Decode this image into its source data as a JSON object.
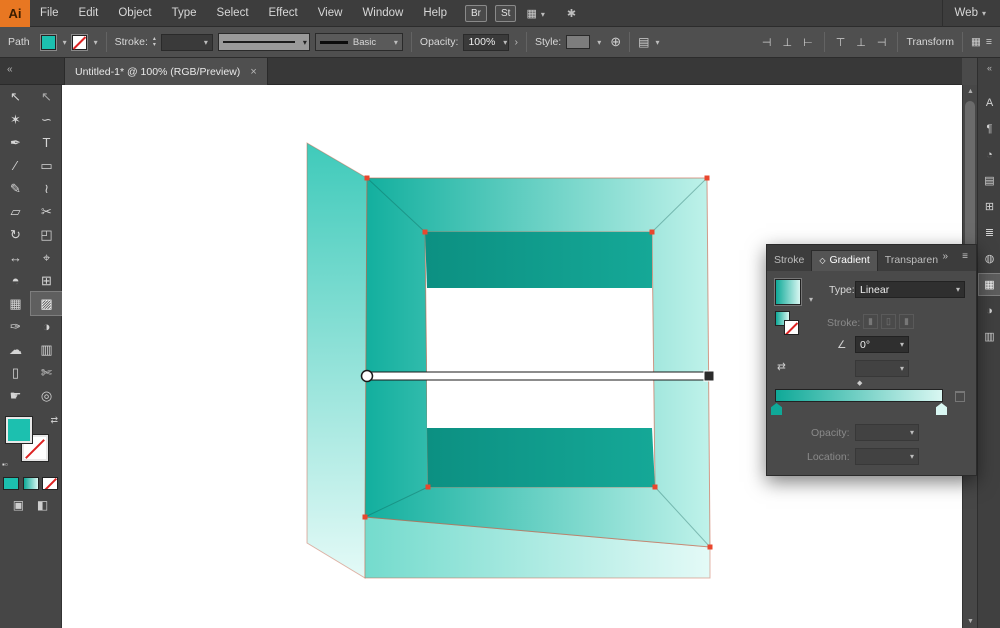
{
  "colors": {
    "teal": "#1CC0AF",
    "grad_left": "#12AF9E",
    "grad_right": "#BFF2EA",
    "face_light_top": "#3FCABA",
    "face_light_bottom": "#E4FAF7",
    "bottom_left": "#74DBCD",
    "bottom_right": "#E4FAF7",
    "wall_dark": "#0C9082",
    "wall_dark2": "#15A897",
    "anchor": "#E9472E"
  },
  "menubar": {
    "logo": "Ai",
    "items": [
      "File",
      "Edit",
      "Object",
      "Type",
      "Select",
      "Effect",
      "View",
      "Window",
      "Help"
    ],
    "br": "Br",
    "st": "St",
    "workspace": "Web"
  },
  "controlbar": {
    "path": "Path",
    "stroke_label": "Stroke:",
    "brush": "Basic",
    "opacity_label": "Opacity:",
    "opacity": "100%",
    "style_label": "Style:",
    "transform": "Transform",
    "align_icons": [
      "⊣",
      "⊥",
      "⊢",
      "⊤",
      "⊥",
      "⊣"
    ]
  },
  "tab": {
    "title": "Untitled-1* @ 100% (RGB/Preview)",
    "close": "×"
  },
  "tools": [
    {
      "name": "selection-tool",
      "glyph": "↖"
    },
    {
      "name": "direct-selection-tool",
      "glyph": "↖"
    },
    {
      "name": "magic-wand-tool",
      "glyph": "✶"
    },
    {
      "name": "lasso-tool",
      "glyph": "∽"
    },
    {
      "name": "pen-tool",
      "glyph": "✒"
    },
    {
      "name": "type-tool",
      "glyph": "T"
    },
    {
      "name": "line-tool",
      "glyph": "∕"
    },
    {
      "name": "rectangle-tool",
      "glyph": "▭"
    },
    {
      "name": "paintbrush-tool",
      "glyph": "✎"
    },
    {
      "name": "pencil-tool",
      "glyph": "≀"
    },
    {
      "name": "eraser-tool",
      "glyph": "▱"
    },
    {
      "name": "scissors-tool",
      "glyph": "✂"
    },
    {
      "name": "rotate-tool",
      "glyph": "↻"
    },
    {
      "name": "scale-tool",
      "glyph": "◰"
    },
    {
      "name": "width-tool",
      "glyph": "↔"
    },
    {
      "name": "free-transform-tool",
      "glyph": "⌖"
    },
    {
      "name": "shape-builder-tool",
      "glyph": "◓"
    },
    {
      "name": "perspective-grid-tool",
      "glyph": "⊞"
    },
    {
      "name": "mesh-tool",
      "glyph": "▦"
    },
    {
      "name": "gradient-tool",
      "glyph": "▨"
    },
    {
      "name": "eyedropper-tool",
      "glyph": "✑"
    },
    {
      "name": "blend-tool",
      "glyph": "◑"
    },
    {
      "name": "symbol-sprayer-tool",
      "glyph": "☁"
    },
    {
      "name": "column-graph-tool",
      "glyph": "▥"
    },
    {
      "name": "artboard-tool",
      "glyph": "▯"
    },
    {
      "name": "slice-tool",
      "glyph": "✄"
    },
    {
      "name": "hand-tool",
      "glyph": "☛"
    },
    {
      "name": "zoom-tool",
      "glyph": "◎"
    }
  ],
  "right_strip": [
    {
      "name": "character-panel-icon",
      "glyph": "A"
    },
    {
      "name": "paragraph-panel-icon",
      "glyph": "¶"
    },
    {
      "name": "color-panel-icon",
      "glyph": "◔"
    },
    {
      "name": "swatches-panel-icon",
      "glyph": "▤"
    },
    {
      "name": "symbols-panel-icon",
      "glyph": "⊞"
    },
    {
      "name": "stroke-panel-icon",
      "glyph": "≣"
    },
    {
      "name": "appearance-panel-icon",
      "glyph": "◍"
    },
    {
      "name": "gradient-panel-icon",
      "glyph": "▦"
    },
    {
      "name": "transparency-panel-icon",
      "glyph": "◑"
    },
    {
      "name": "layers-panel-icon",
      "glyph": "▥"
    }
  ],
  "gradient_panel": {
    "tabs": [
      "Stroke",
      "Gradient",
      "Transparen"
    ],
    "type_label": "Type:",
    "type_value": "Linear",
    "stroke_label": "Stroke:",
    "angle_value": "0°",
    "opacity_label": "Opacity:",
    "location_label": "Location:"
  },
  "icons": {
    "collapse": "«",
    "chevrons": "»",
    "menu": "≡",
    "dropdown": "▾",
    "spin_up": "▴",
    "spin_down": "▾",
    "globe": "⊕",
    "grid": "▦",
    "sparkle": "✱",
    "doc": "▤",
    "more": "›",
    "swap": "⇄",
    "mini_swatches": "▪▫",
    "draw_mode": "▣",
    "screen_mode": "◧",
    "diamond": "◇",
    "midpoint": "◆",
    "reverse": "⇄",
    "angle": "∠",
    "scroll_up": "▲",
    "scroll_down": "▼",
    "panel_boxes": [
      "▮",
      "▯",
      "▮"
    ]
  }
}
